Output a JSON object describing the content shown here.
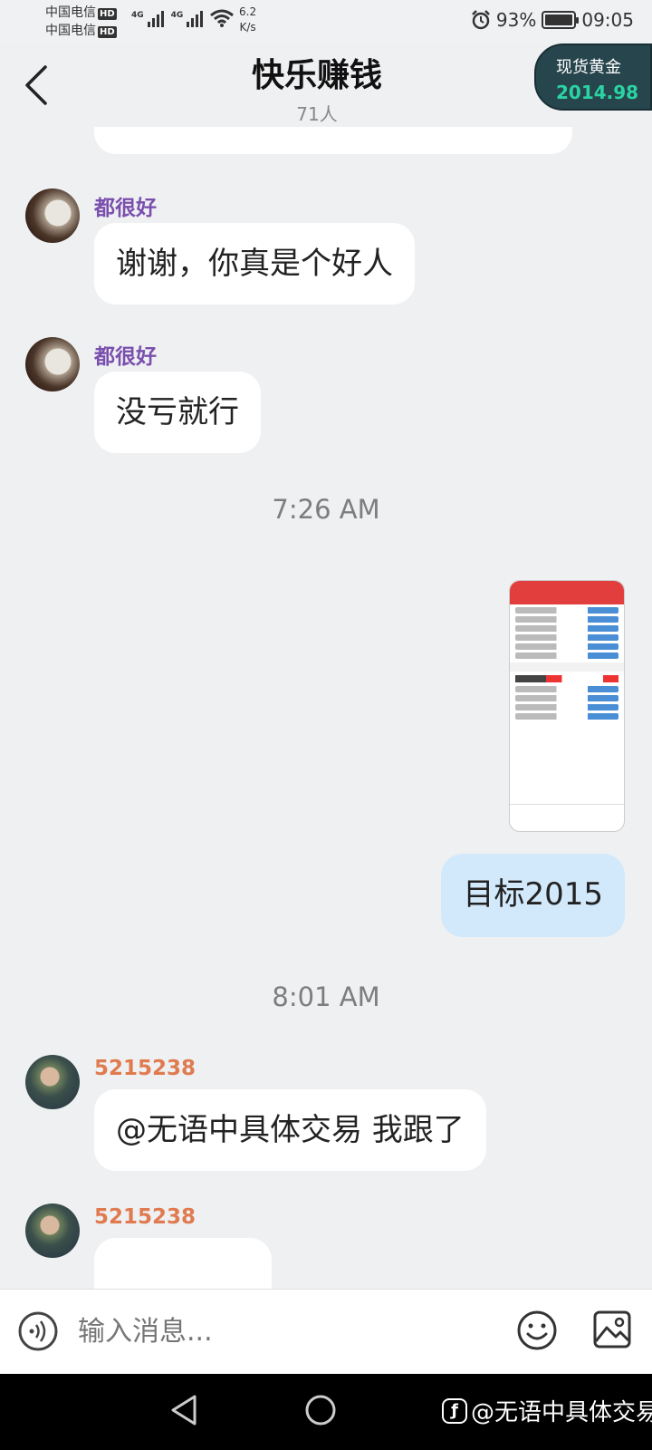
{
  "status_bar": {
    "carrier1": "中国电信",
    "carrier2": "中国电信",
    "hd": "HD",
    "net1": "4G",
    "net2": "4G",
    "speed_value": "6.2",
    "speed_unit": "K/s",
    "battery": "93%",
    "time": "09:05"
  },
  "header": {
    "title": "快乐赚钱",
    "members": "71人",
    "ticker_label": "现货黄金",
    "ticker_price": "2014.98"
  },
  "messages": [
    {
      "sender": "都很好",
      "text": "谢谢，你真是个好人"
    },
    {
      "sender": "都很好",
      "text": "没亏就行"
    },
    {
      "timestamp": "7:26 AM"
    },
    {
      "outgoing_text": "目标2015"
    },
    {
      "timestamp": "8:01 AM"
    },
    {
      "sender": "5215238",
      "text": "@无语中具体交易 我跟了"
    },
    {
      "sender": "5215238",
      "text": ""
    }
  ],
  "input": {
    "placeholder": "输入消息..."
  },
  "watermark": "@无语中具体交易",
  "colors": {
    "sender_purple": "#7a4fae",
    "sender_orange": "#e07a4f",
    "outgoing_bubble": "#d2e8fb",
    "ticker_bg": "#27454d",
    "ticker_price": "#2bd3a3"
  }
}
